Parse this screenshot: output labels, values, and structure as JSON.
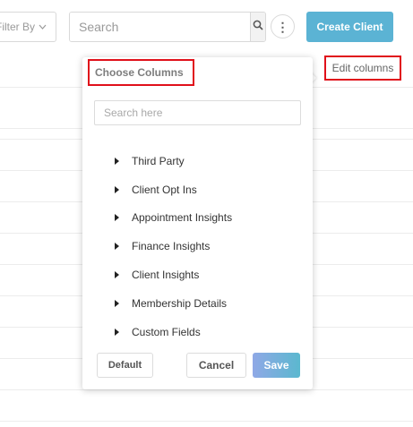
{
  "toolbar": {
    "filter_label": "Filter By",
    "search_placeholder": "Search",
    "more_label": "⋮",
    "create_label": "Create Client"
  },
  "table": {
    "edit_columns_label": "Edit columns"
  },
  "choose_columns": {
    "title": "Choose Columns",
    "search_placeholder": "Search here",
    "groups": [
      {
        "label": "Third Party"
      },
      {
        "label": "Client Opt Ins"
      },
      {
        "label": "Appointment Insights"
      },
      {
        "label": "Finance Insights"
      },
      {
        "label": "Client Insights"
      },
      {
        "label": "Membership Details"
      },
      {
        "label": "Custom Fields"
      }
    ],
    "default_label": "Default",
    "cancel_label": "Cancel",
    "save_label": "Save"
  },
  "colors": {
    "accent": "#5bb3d4",
    "highlight": "#e0101a"
  }
}
